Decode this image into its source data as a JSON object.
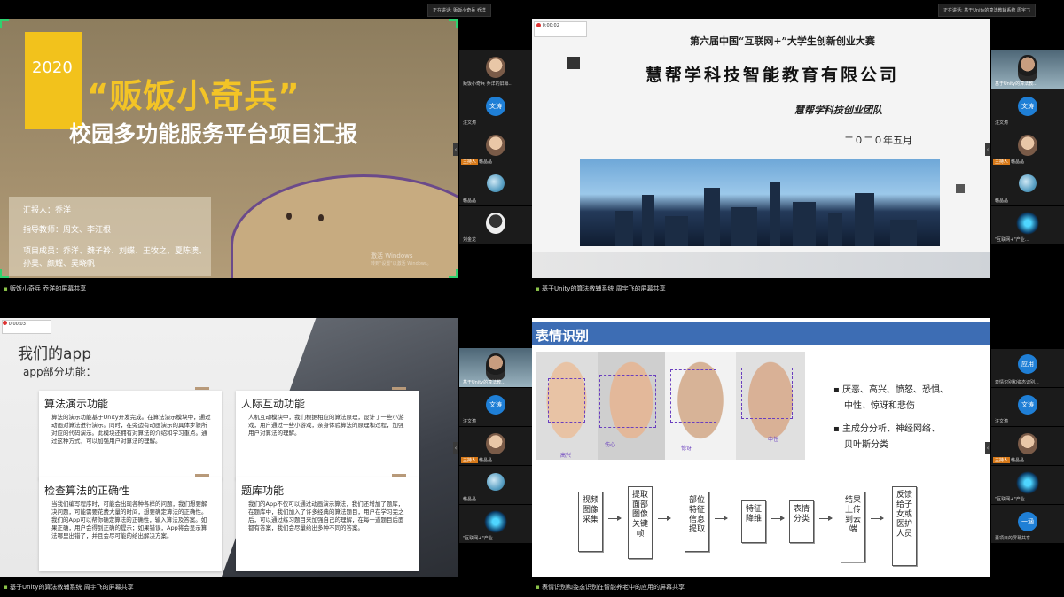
{
  "pane1": {
    "talking": "正在讲话: 贩饭小奇兵 乔洋",
    "year": "2020",
    "title": "“贩饭小奇兵”",
    "subtitle": "校园多功能服务平台项目汇报",
    "reporter": "汇报人：乔洋",
    "advisor": "指导教师：周文、李汪根",
    "members_1": "项目成员：乔洋、魏子衿、刘蝶、王牧之、夏陈澳、",
    "members_2": "孙昊、颜耀、吴晓帆",
    "watermark_1": "激活 Windows",
    "watermark_2": "转到\"设置\"以激活 Windows。",
    "share_label": "贩饭小奇兵 乔洋的屏幕共享",
    "tiles": [
      "贩饭小奇兵 乔洋的屏幕...",
      "文涛",
      "汪文涛",
      "主持人",
      "韩晶晶",
      "韩晶晶",
      "刘金龙"
    ]
  },
  "pane2": {
    "talking": "正在讲话: 基于Unity的算法教辅系统 周宇飞",
    "rec_time": "0:00:02",
    "line1": "第六届中国“互联网+”大学生创新创业大赛",
    "line2": "慧帮学科技智能教育有限公司",
    "line3": "慧帮学科技创业团队",
    "line4": "二０二０年五月",
    "share_label": "基于Unity的算法教辅系统 周宇飞的屏幕共享",
    "tiles": [
      "基于Unity的算法教...",
      "文涛",
      "汪文涛",
      "主持人",
      "韩晶晶",
      "韩晶晶",
      "\"互联网+\"产业..."
    ]
  },
  "pane3": {
    "rec_time": "0:00:03",
    "title": "我们的app",
    "subtitle": "app部分功能：",
    "cards": [
      {
        "title": "算法演示功能",
        "body": "算法的演示功能基于Unity开发完成。在算法演示模块中，通过动画对算法进行演示。同时，在旁边有动画演示的具体步骤所对应的代码演示。此模块还拥有对算法的介绍和学习重点。通过这种方式，可以加强用户对算法的理解。"
      },
      {
        "title": "人际互动功能",
        "body": "人机互动模块中，我们根据相应的算法原理，设计了一些小游戏，用户通过一些小游戏，亲身体验算法的原理和过程，加强用户对算法的理解。"
      },
      {
        "title": "检查算法的正确性",
        "body": "当我们编写程序时，可能会出现各种各样的问题，我们想要解决问题，可能需要花费大量的时间，想要确定算法的正确性。我们的App可以帮你确定算法的正确性，输入算法及答案。如果正确，用户会得到正确的提示；如果错误，App将会显示算法哪里出错了，并且会尽可能的给出解决方案。"
      },
      {
        "title": "题库功能",
        "body": "我们的App不仅可以通过动画演示算法，我们还增加了题库，在题库中，我们加入了许多经典的算法题目，用户在学习完之后，可以通过练习题目来加强自己的理解，在每一道题目后面都有答案，我们会尽量给出多种不同的答案。"
      }
    ],
    "share_label": "基于Unity的算法教辅系统 周宇飞的屏幕共享",
    "tiles": [
      "基于Unity的算法教...",
      "文涛",
      "汪文涛",
      "主持人",
      "韩晶晶",
      "韩晶晶",
      "\"互联网+\"产业..."
    ]
  },
  "pane4": {
    "title": "表情识别",
    "labels": [
      "高兴",
      "伤心",
      "惊讶",
      "中性"
    ],
    "bullet1_a": "厌恶、高兴、愤怒、恐惧、",
    "bullet1_b": "中性、惊讶和悲伤",
    "bullet2_a": "主成分分析、神经网络、",
    "bullet2_b": "贝叶斯分类",
    "flow": [
      "视频图像采集",
      "提取面部图像关键帧",
      "部位特征信息提取",
      "特征降维",
      "表情分类",
      "结果上传到云端",
      "反馈给子女或医护人员"
    ],
    "share_label": "表情识别和姿态识别在智能养老中的应用的屏幕共享",
    "tiles": [
      "应用",
      "表情识别和姿态识别...",
      "文涛",
      "汪文涛",
      "主持人",
      "韩晶晶",
      "韩晶晶",
      "\"互联网+\"产业...",
      "一涵",
      "董项目的屏幕共享"
    ]
  }
}
